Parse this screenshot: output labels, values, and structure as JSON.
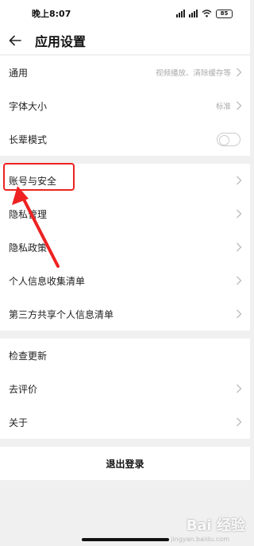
{
  "status_bar": {
    "time": "晚上8:07",
    "battery": "85"
  },
  "header": {
    "title": "应用设置"
  },
  "groups": [
    {
      "items": [
        {
          "label": "通用",
          "value": "视频播放、清除缓存等"
        },
        {
          "label": "字体大小",
          "value": "标准"
        },
        {
          "label": "长辈模式"
        }
      ]
    },
    {
      "items": [
        {
          "label": "账号与安全"
        },
        {
          "label": "隐私管理"
        },
        {
          "label": "隐私政策"
        },
        {
          "label": "个人信息收集清单"
        },
        {
          "label": "第三方共享个人信息清单"
        }
      ]
    },
    {
      "items": [
        {
          "label": "检查更新"
        },
        {
          "label": "去评价"
        },
        {
          "label": "关于"
        }
      ]
    }
  ],
  "logout_label": "退出登录",
  "watermark": {
    "text": "Bai 经验",
    "sub": "jingyan.baidu.com"
  },
  "colors": {
    "highlight": "#ee2222",
    "chevron": "#bbbbbb"
  }
}
